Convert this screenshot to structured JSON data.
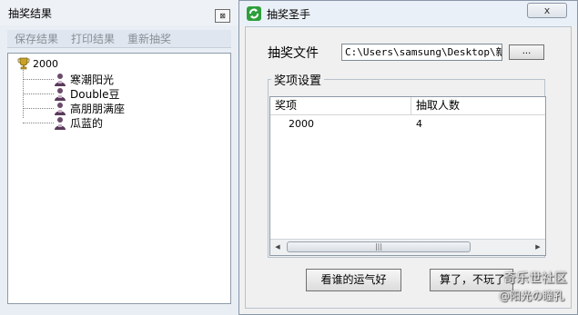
{
  "results_window": {
    "title": "抽奖结果",
    "close_glyph": "⊠",
    "menu": [
      "保存结果",
      "打印结果",
      "重新抽奖"
    ],
    "tree": {
      "root_label": "2000",
      "root_icon": "trophy-icon",
      "children": [
        "寒潮阳光",
        "Double豆",
        "高朋朋满座",
        "瓜蓝的"
      ],
      "child_icon": "user-icon"
    }
  },
  "main_window": {
    "title": "抽奖圣手",
    "close_glyph": "x",
    "file_label": "抽奖文件",
    "file_path": "C:\\Users\\samsung\\Desktop\\新建",
    "browse_label": "...",
    "group_title": "奖项设置",
    "columns": [
      "奖项",
      "抽取人数"
    ],
    "rows": [
      {
        "prize": "2000",
        "count": "4"
      }
    ],
    "scroll_thumb_glyph": "|||",
    "scroll_left_glyph": "◀",
    "scroll_right_glyph": "▶",
    "lucky_button": "看谁的运气好",
    "quit_button": "算了，不玩了"
  },
  "watermark": {
    "line1": "奇乐世社区",
    "line2": "@阳光の瞳孔"
  },
  "colors": {
    "app_icon": "#2d9f3c",
    "trophy": "#c9a227",
    "menu_disabled_text": "#8a8f96"
  }
}
